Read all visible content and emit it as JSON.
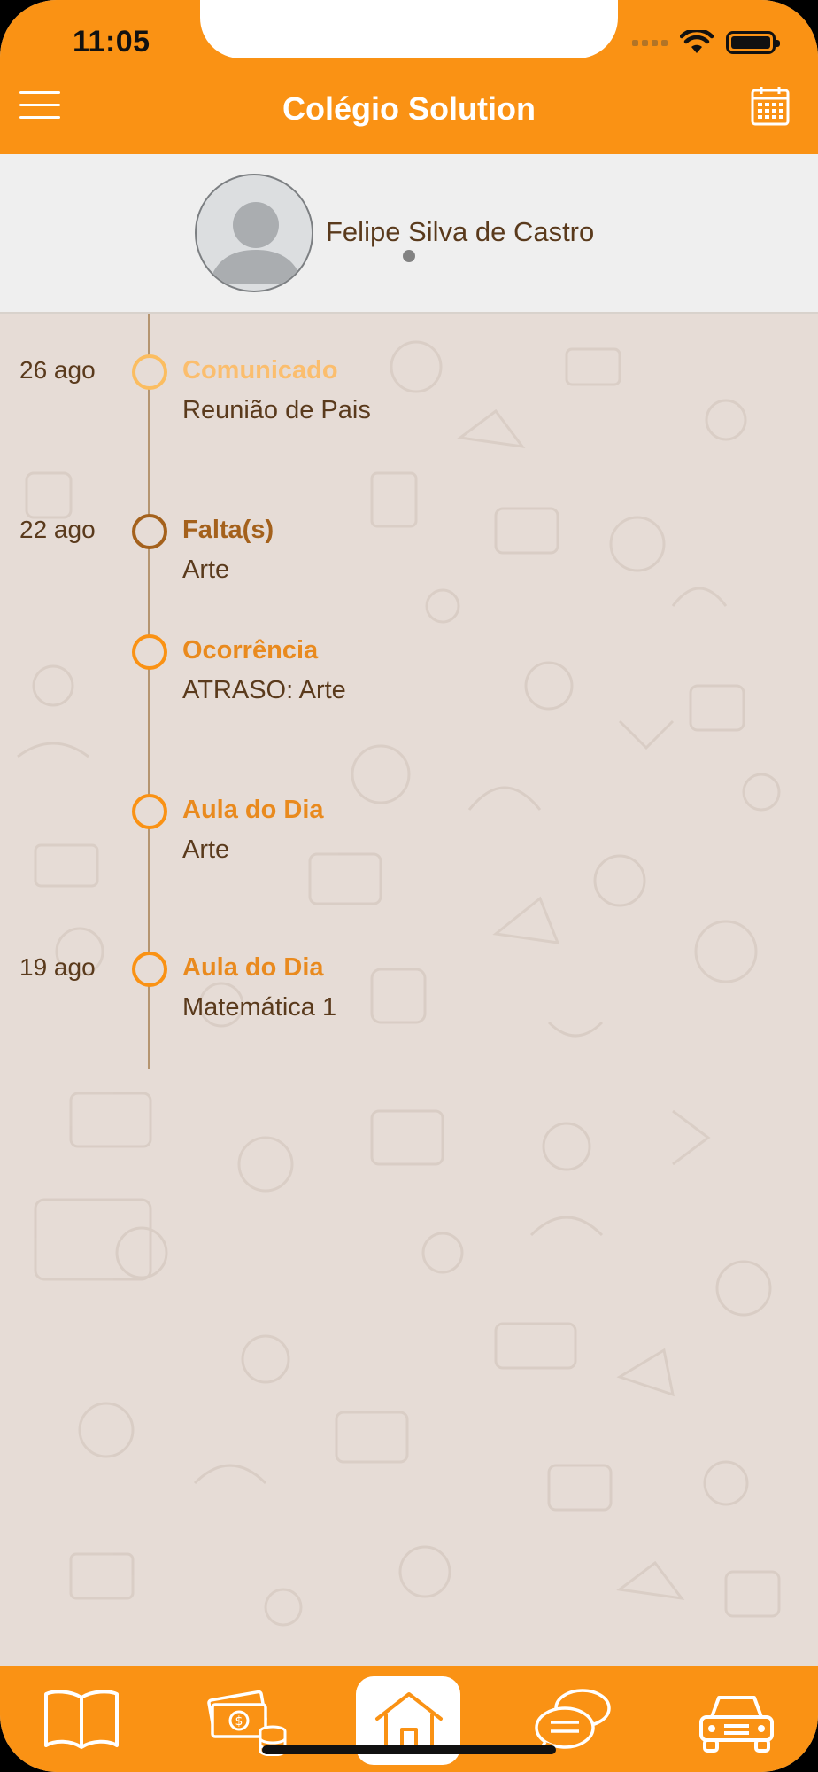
{
  "status_bar": {
    "time": "11:05"
  },
  "header": {
    "title": "Colégio Solution"
  },
  "profile": {
    "name": "Felipe Silva de Castro"
  },
  "timeline": [
    {
      "date": "26 ago",
      "title": "Comunicado",
      "subtitle": "Reunião de Pais",
      "style": "light"
    },
    {
      "date": "22 ago",
      "title": "Falta(s)",
      "subtitle": "Arte",
      "style": "brown"
    },
    {
      "date": "",
      "title": "Ocorrência",
      "subtitle": "ATRASO: Arte",
      "style": "orange"
    },
    {
      "date": "",
      "title": "Aula do Dia",
      "subtitle": "Arte",
      "style": "orange"
    },
    {
      "date": "19 ago",
      "title": "Aula do Dia",
      "subtitle": "Matemática 1",
      "style": "orange"
    }
  ],
  "tabbar": {
    "tabs": [
      {
        "icon": "book-icon"
      },
      {
        "icon": "money-icon"
      },
      {
        "icon": "home-icon",
        "active": true
      },
      {
        "icon": "chat-icon"
      },
      {
        "icon": "car-icon"
      }
    ]
  },
  "colors": {
    "accent": "#fa9214",
    "background": "#e6dcd6",
    "text_brown": "#5a3a1c",
    "light_orange": "#fbbd60",
    "dark_orange": "#a4611c"
  }
}
